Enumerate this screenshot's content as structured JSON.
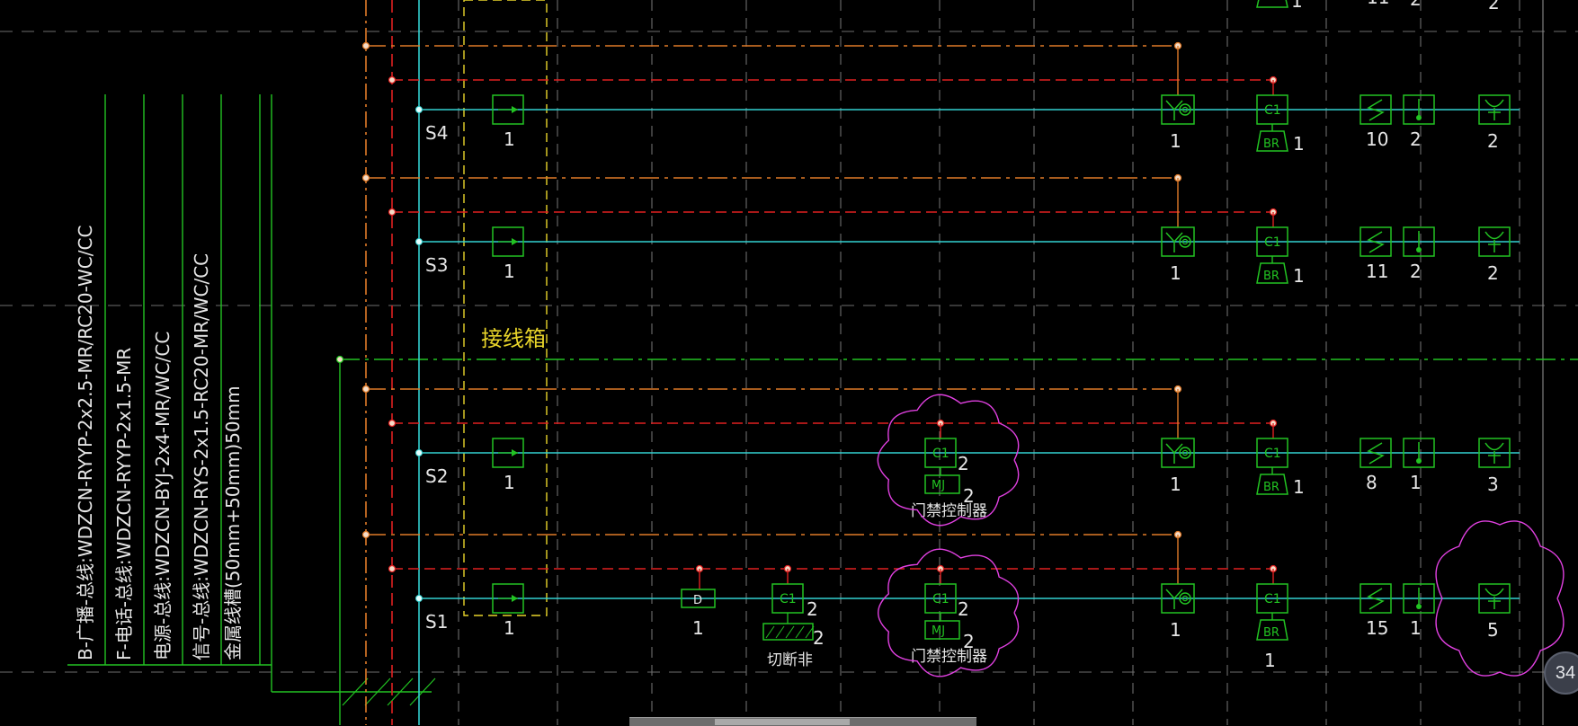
{
  "junction_box_label": "接线箱",
  "legend": [
    "B-广播-总线:WDZCN-RYYP-2x2.5-MR/RC20-WC/CC",
    "F-电话-总线:WDZCN-RYYP-2x1.5-MR",
    "电源-总线:WDZCN-BYJ-2x4-MR/WC/CC",
    "信号-总线:WDZCN-RYS-2x1.5-RC20-MR/WC/CC",
    "金属线槽(50mm+50mm)50mm"
  ],
  "rows": [
    {
      "id": "S4",
      "box_count": "1",
      "speaker_count": "1",
      "c1_count": "1",
      "switch_count": "10",
      "pushbutton_count": "2",
      "antenna_count": "2"
    },
    {
      "id": "S3",
      "box_count": "1",
      "speaker_count": "1",
      "c1_count": "1",
      "switch_count": "11",
      "pushbutton_count": "2",
      "antenna_count": "2"
    },
    {
      "id": "S2",
      "box_count": "1",
      "speaker_count": "1",
      "c1_count": "1",
      "switch_count": "8",
      "pushbutton_count": "1",
      "antenna_count": "3"
    },
    {
      "id": "S1",
      "box_count": "1",
      "speaker_count": "1",
      "c1_count": "1",
      "switch_count": "15",
      "pushbutton_count": "1",
      "antenna_count": "5"
    }
  ],
  "top_partial_counts": [
    "1",
    "11",
    "2",
    "2"
  ],
  "access_controllers": [
    {
      "c1_symbol": "C1",
      "c1_count": "2",
      "mj_symbol": "MJ",
      "mj_count": "2",
      "label": "门禁控制器"
    },
    {
      "c1_symbol": "C1",
      "c1_count": "2",
      "mj_symbol": "MJ",
      "mj_count": "2",
      "label": "门禁控制器"
    }
  ],
  "s1_extras": {
    "d_symbol": "D",
    "d_count": "1",
    "c1_symbol": "C1",
    "c1_count": "2",
    "cutoff_count": "2",
    "cutoff_label": "切断非"
  },
  "symbols": {
    "c1": "C1",
    "br": "BR"
  },
  "badge": "34",
  "colors": {
    "background": "#000000",
    "cyan_bus": "#33d1d1",
    "green_device": "#22c322",
    "red_line": "#e02020",
    "orange_line": "#e07a28",
    "yellow_text": "#e8d42a",
    "magenta_cloud": "#e040e0",
    "grid": "#6e6e6e"
  }
}
